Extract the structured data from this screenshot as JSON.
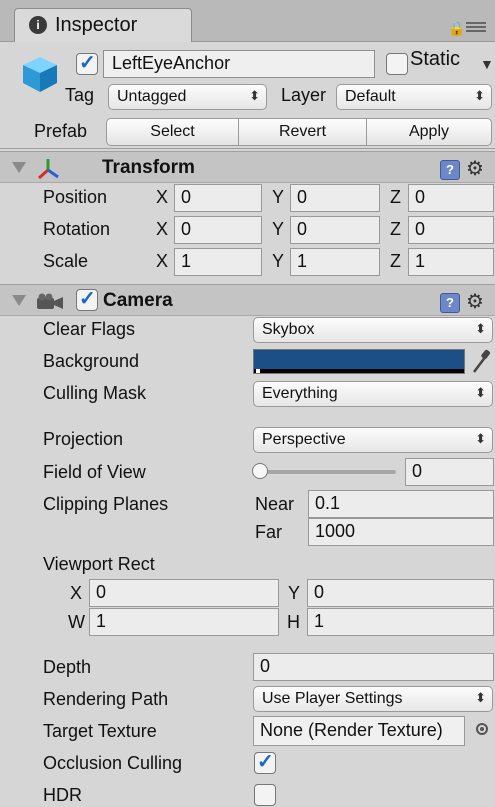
{
  "tab": {
    "icon": "info-circle-icon",
    "title": "Inspector"
  },
  "header": {
    "object_name": "LeftEyeAnchor",
    "active": true,
    "static_label": "Static",
    "static_checked": false,
    "tag_label": "Tag",
    "tag_value": "Untagged",
    "layer_label": "Layer",
    "layer_value": "Default",
    "prefab_label": "Prefab",
    "prefab_buttons": [
      "Select",
      "Revert",
      "Apply"
    ]
  },
  "transform": {
    "title": "Transform",
    "rows": [
      {
        "label": "Position",
        "x": "0",
        "y": "0",
        "z": "0"
      },
      {
        "label": "Rotation",
        "x": "0",
        "y": "0",
        "z": "0"
      },
      {
        "label": "Scale",
        "x": "1",
        "y": "1",
        "z": "1"
      }
    ],
    "axis_labels": [
      "X",
      "Y",
      "Z"
    ]
  },
  "camera": {
    "title": "Camera",
    "enabled": true,
    "clear_flags_label": "Clear Flags",
    "clear_flags_value": "Skybox",
    "background_label": "Background",
    "background_color": "#1b4f85",
    "culling_mask_label": "Culling Mask",
    "culling_mask_value": "Everything",
    "projection_label": "Projection",
    "projection_value": "Perspective",
    "fov_label": "Field of View",
    "fov_value": "0",
    "clipping_label": "Clipping Planes",
    "near_label": "Near",
    "near_value": "0.1",
    "far_label": "Far",
    "far_value": "1000",
    "viewport_label": "Viewport Rect",
    "viewport": {
      "x_label": "X",
      "x": "0",
      "y_label": "Y",
      "y": "0",
      "w_label": "W",
      "w": "1",
      "h_label": "H",
      "h": "1"
    },
    "depth_label": "Depth",
    "depth_value": "0",
    "rendering_path_label": "Rendering Path",
    "rendering_path_value": "Use Player Settings",
    "target_texture_label": "Target Texture",
    "target_texture_value": "None (Render Texture)",
    "occlusion_label": "Occlusion Culling",
    "occlusion_checked": true,
    "hdr_label": "HDR",
    "hdr_checked": false
  }
}
